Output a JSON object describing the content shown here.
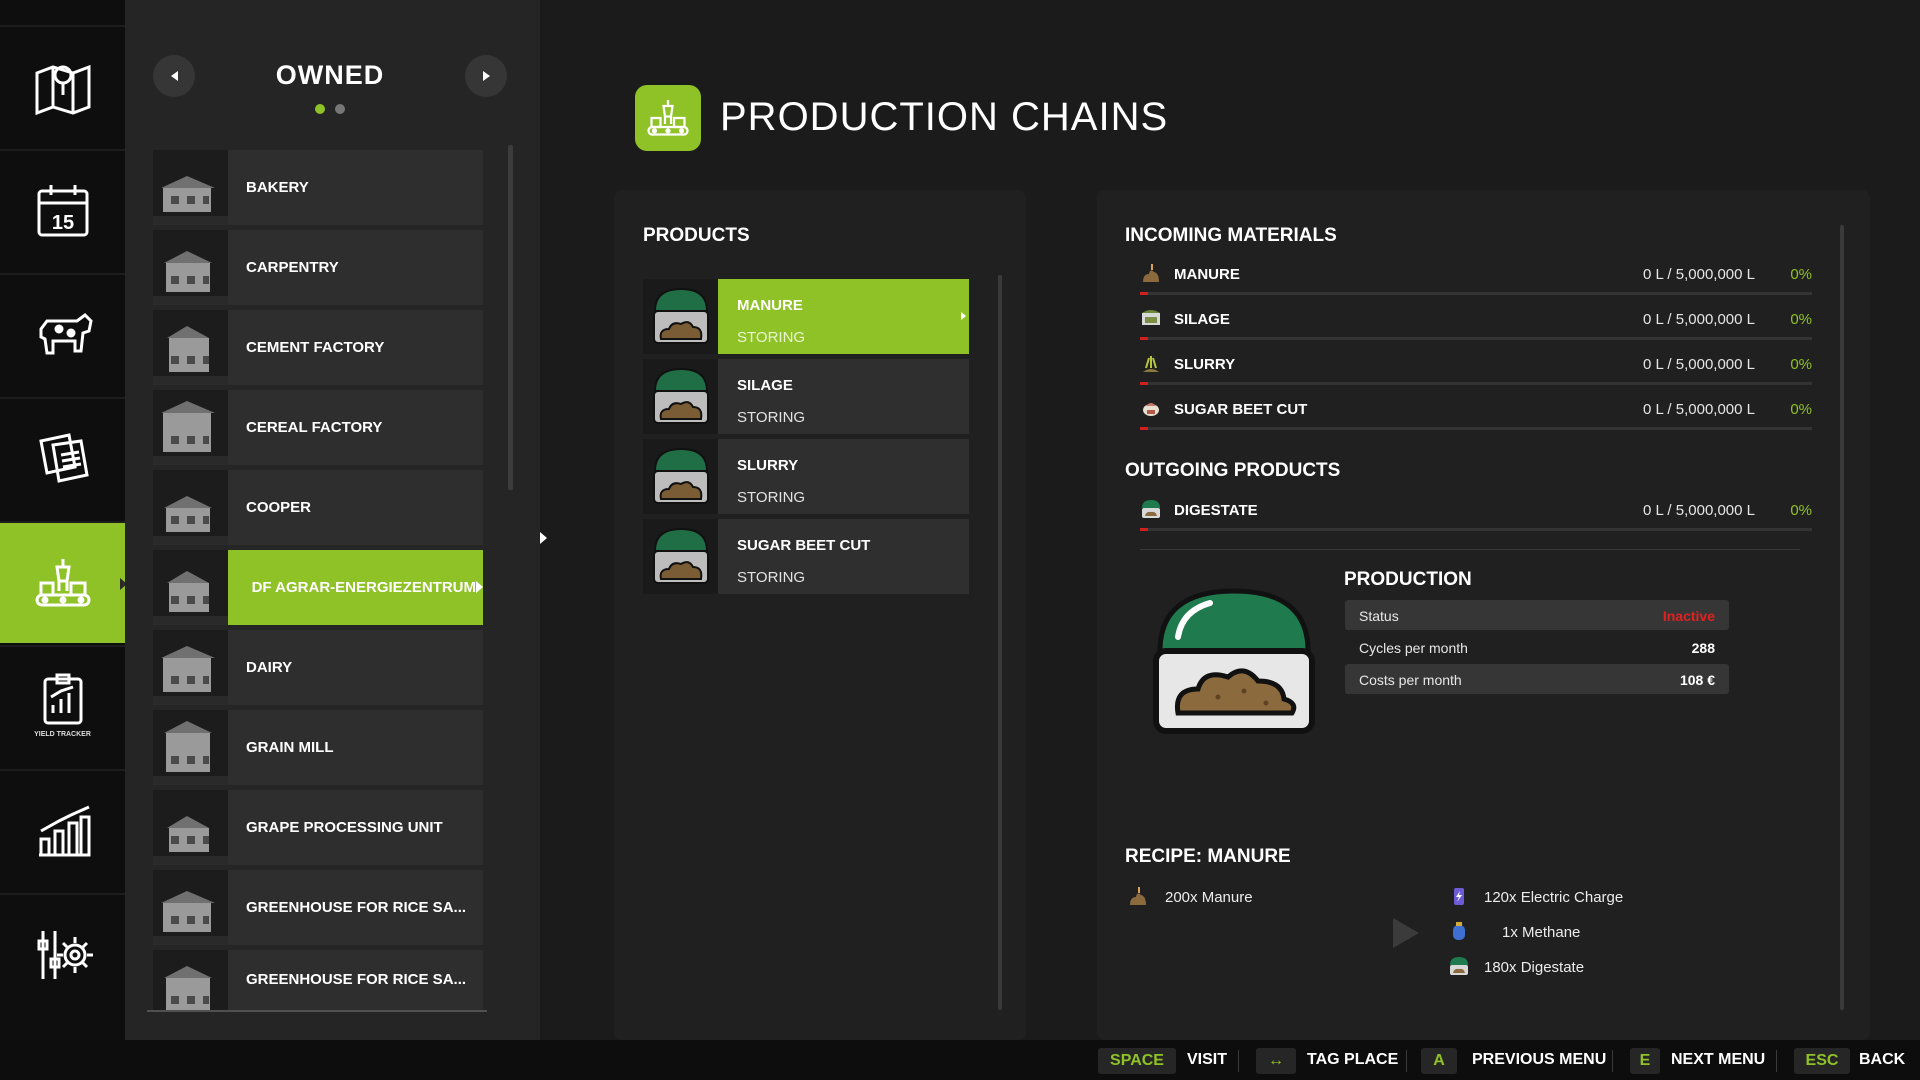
{
  "rail": {
    "items": [
      {
        "icon": "map-icon"
      },
      {
        "icon": "calendar-icon",
        "day": "15"
      },
      {
        "icon": "cow-icon"
      },
      {
        "icon": "contracts-icon"
      },
      {
        "icon": "production-icon"
      },
      {
        "icon": "yield-tracker-icon",
        "caption": "YIELD TRACKER"
      },
      {
        "icon": "statistics-icon"
      },
      {
        "icon": "settings-icon"
      }
    ],
    "active_index": 4
  },
  "owned": {
    "title": "OWNED",
    "page_count": 2,
    "current_page": 1,
    "items": [
      {
        "label": "BAKERY"
      },
      {
        "label": "CARPENTRY"
      },
      {
        "label": "CEMENT FACTORY"
      },
      {
        "label": "CEREAL FACTORY"
      },
      {
        "label": "COOPER"
      },
      {
        "label": "DF AGRAR-ENERGIEZENTRUM !"
      },
      {
        "label": "DAIRY"
      },
      {
        "label": "GRAIN MILL"
      },
      {
        "label": "GRAPE PROCESSING UNIT"
      },
      {
        "label": "GREENHOUSE FOR RICE SA..."
      },
      {
        "label": "GREENHOUSE FOR RICE SA..."
      }
    ],
    "selected_index": 5
  },
  "header": {
    "title": "PRODUCTION CHAINS",
    "icon": "production-icon"
  },
  "products": {
    "title": "PRODUCTS",
    "items": [
      {
        "name": "MANURE",
        "state": "STORING"
      },
      {
        "name": "SILAGE",
        "state": "STORING"
      },
      {
        "name": "SLURRY",
        "state": "STORING"
      },
      {
        "name": "SUGAR BEET CUT",
        "state": "STORING"
      }
    ],
    "selected_index": 0
  },
  "incoming": {
    "title": "INCOMING MATERIALS",
    "items": [
      {
        "name": "MANURE",
        "amount": "0 L / 5,000,000 L",
        "percent": "0%",
        "fill": 0,
        "icon": "manure-icon"
      },
      {
        "name": "SILAGE",
        "amount": "0 L / 5,000,000 L",
        "percent": "0%",
        "fill": 0,
        "icon": "silage-icon"
      },
      {
        "name": "SLURRY",
        "amount": "0 L / 5,000,000 L",
        "percent": "0%",
        "fill": 0,
        "icon": "slurry-icon"
      },
      {
        "name": "SUGAR BEET CUT",
        "amount": "0 L / 5,000,000 L",
        "percent": "0%",
        "fill": 0,
        "icon": "sugar-beet-cut-icon"
      }
    ]
  },
  "outgoing": {
    "title": "OUTGOING PRODUCTS",
    "items": [
      {
        "name": "DIGESTATE",
        "amount": "0 L / 5,000,000 L",
        "percent": "0%",
        "fill": 0,
        "icon": "digestate-icon"
      }
    ]
  },
  "production": {
    "title": "PRODUCTION",
    "status_label": "Status",
    "status_value": "Inactive",
    "cycles_label": "Cycles per month",
    "cycles_value": "288",
    "costs_label": "Costs per month",
    "costs_value": "108 €"
  },
  "recipe": {
    "title": "RECIPE: MANURE",
    "inputs": [
      {
        "text": "200x Manure",
        "icon": "manure-icon"
      }
    ],
    "outputs": [
      {
        "text": "120x Electric Charge",
        "icon": "electric-charge-icon"
      },
      {
        "text": "1x Methane",
        "icon": "methane-icon"
      },
      {
        "text": "180x Digestate",
        "icon": "digestate-icon"
      }
    ]
  },
  "actions": [
    {
      "key": "SPACE",
      "label": "VISIT"
    },
    {
      "key": "↔",
      "label": "TAG PLACE"
    },
    {
      "key": "A",
      "label": "PREVIOUS MENU"
    },
    {
      "key": "E",
      "label": "NEXT MENU"
    },
    {
      "key": "ESC",
      "label": "BACK"
    }
  ],
  "colors": {
    "accent": "#8fc227",
    "inactive": "#e0211f",
    "fill_bar": "#d11f1f"
  }
}
